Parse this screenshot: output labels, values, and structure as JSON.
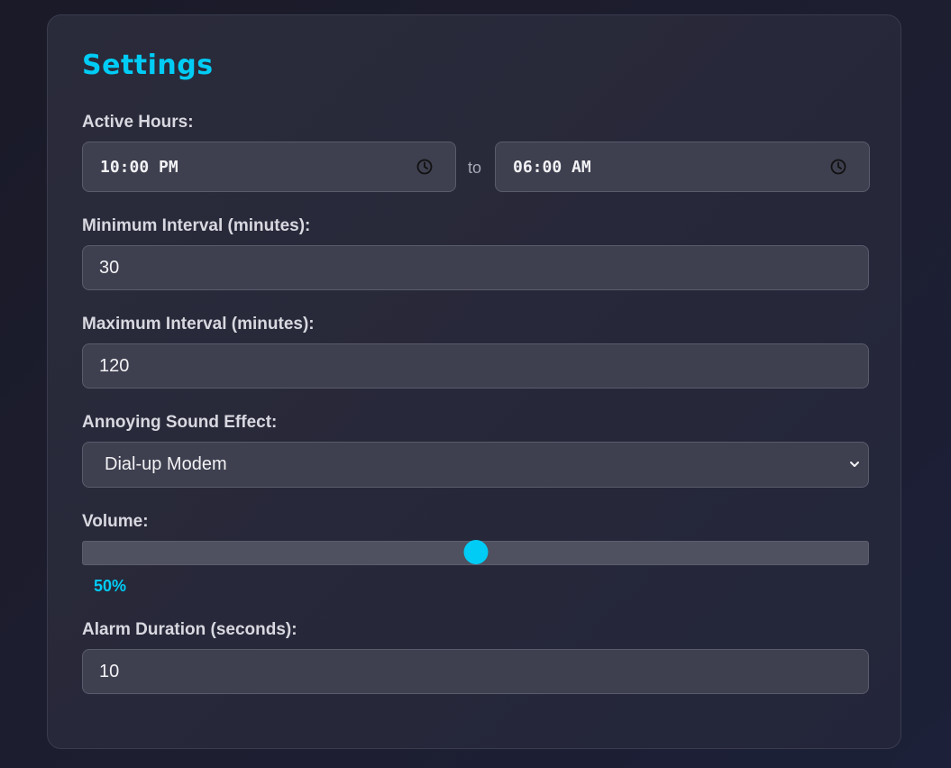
{
  "settings": {
    "title": "Settings",
    "active_hours": {
      "label": "Active Hours:",
      "start": "10:00 PM",
      "separator": "to",
      "end": "06:00 AM",
      "icon": "clock-icon"
    },
    "min_interval": {
      "label": "Minimum Interval (minutes):",
      "value": "30"
    },
    "max_interval": {
      "label": "Maximum Interval (minutes):",
      "value": "120"
    },
    "sound_effect": {
      "label": "Annoying Sound Effect:",
      "selected": "Dial-up Modem",
      "icon": "chevron-down-icon"
    },
    "volume": {
      "label": "Volume:",
      "percent": 50,
      "display": "50%"
    },
    "alarm_duration": {
      "label": "Alarm Duration (seconds):",
      "value": "10"
    },
    "colors": {
      "accent": "#00ccf5",
      "background": "#1c1d2c",
      "panel": "#272839",
      "field": "#3e3f4f"
    }
  }
}
